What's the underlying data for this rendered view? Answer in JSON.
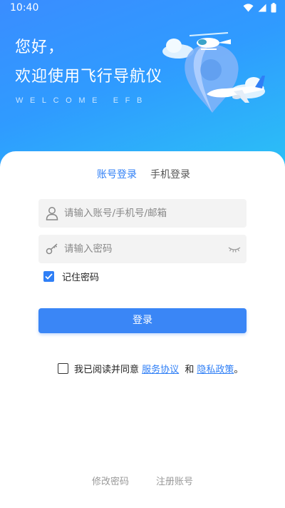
{
  "status_bar": {
    "time": "10:40",
    "icons": [
      "wifi-icon",
      "signal-icon",
      "battery-icon"
    ]
  },
  "header": {
    "greeting": "您好，",
    "welcome": "欢迎使用飞行导航仪",
    "welcome_en": "WELCOME EFB",
    "illustration_icons": [
      "map-pin-icon",
      "helicopter-icon",
      "airplane-icon",
      "cloud-icon"
    ]
  },
  "tabs": {
    "items": [
      {
        "label": "账号登录",
        "active": true
      },
      {
        "label": "手机登录",
        "active": false
      }
    ]
  },
  "form": {
    "username_placeholder": "请输入账号/手机号/邮箱",
    "username_value": "",
    "password_placeholder": "请输入密码",
    "password_value": "",
    "remember_label": "记住密码",
    "remember_checked": true,
    "login_label": "登录"
  },
  "agreement": {
    "checked": false,
    "prefix": "我已阅读并同意",
    "service_link": "服务协议",
    "and": "和",
    "privacy_link": "隐私政策",
    "suffix": "。"
  },
  "footer": {
    "change_password": "修改密码",
    "register": "注册账号"
  },
  "colors": {
    "primary": "#3a86f6",
    "hero_start": "#3a8dff",
    "hero_end": "#2bc3f5"
  }
}
